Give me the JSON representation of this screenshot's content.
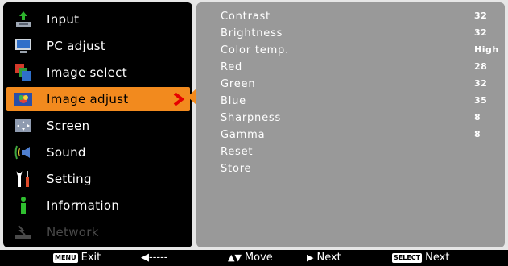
{
  "menu": {
    "items": [
      {
        "label": "Input",
        "icon": "input-icon",
        "selected": false,
        "disabled": false
      },
      {
        "label": "PC adjust",
        "icon": "monitor-icon",
        "selected": false,
        "disabled": false
      },
      {
        "label": "Image select",
        "icon": "image-select-icon",
        "selected": false,
        "disabled": false
      },
      {
        "label": "Image adjust",
        "icon": "image-adjust-icon",
        "selected": true,
        "disabled": false
      },
      {
        "label": "Screen",
        "icon": "screen-icon",
        "selected": false,
        "disabled": false
      },
      {
        "label": "Sound",
        "icon": "speaker-icon",
        "selected": false,
        "disabled": false
      },
      {
        "label": "Setting",
        "icon": "setting-icon",
        "selected": false,
        "disabled": false
      },
      {
        "label": "Information",
        "icon": "information-icon",
        "selected": false,
        "disabled": false
      },
      {
        "label": "Network",
        "icon": "network-icon",
        "selected": false,
        "disabled": true
      }
    ]
  },
  "options": [
    {
      "name": "Contrast",
      "value": "32"
    },
    {
      "name": "Brightness",
      "value": "32"
    },
    {
      "name": "Color temp.",
      "value": "High"
    },
    {
      "name": "Red",
      "value": "28"
    },
    {
      "name": "Green",
      "value": "32"
    },
    {
      "name": "Blue",
      "value": "35"
    },
    {
      "name": "Sharpness",
      "value": "8"
    },
    {
      "name": "Gamma",
      "value": "8"
    },
    {
      "name": "Reset",
      "value": ""
    },
    {
      "name": "Store",
      "value": ""
    }
  ],
  "footer": {
    "exit_key": "MENU",
    "exit_label": "Exit",
    "back_label": "◀-----",
    "move_label": "Move",
    "next_label": "Next",
    "select_key": "SELECT",
    "select_next_label": "Next"
  },
  "colors": {
    "highlight": "#f28a1e",
    "left_panel": "#000000",
    "right_panel": "#999999",
    "frame": "#e6e6e6"
  }
}
